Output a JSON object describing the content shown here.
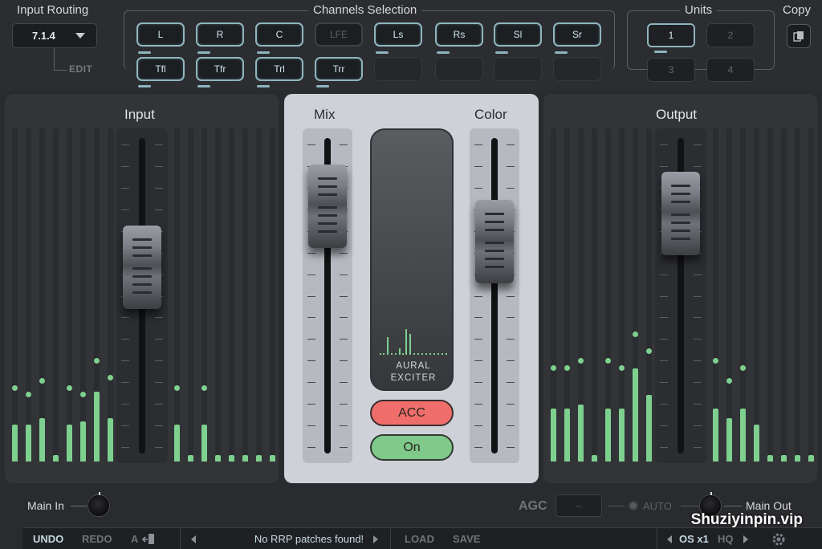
{
  "input_routing": {
    "title": "Input Routing",
    "value": "7.1.4",
    "edit_label": "EDIT"
  },
  "channels": {
    "title": "Channels Selection",
    "row1": [
      "L",
      "R",
      "C",
      "LFE",
      "Ls",
      "Rs",
      "Sl",
      "Sr"
    ],
    "row2": [
      "Tfl",
      "Tfr",
      "Trl",
      "Trr"
    ]
  },
  "units": {
    "title": "Units",
    "items": [
      "1",
      "2",
      "3",
      "4"
    ],
    "active": "1"
  },
  "copy": {
    "label": "Copy"
  },
  "input_panel": {
    "title": "Input",
    "meter_levels": [
      0.11,
      0.11,
      0.13,
      0.02,
      0.11,
      0.12,
      0.21,
      0.13,
      0,
      0.11,
      0.02,
      0.11,
      0.02,
      0.02,
      0.02,
      0.02,
      0.02
    ],
    "meter_peaks": [
      0.23,
      0.21,
      0.25,
      null,
      0.23,
      0.21,
      0.31,
      0.26,
      null,
      0.23,
      null,
      0.23,
      null,
      null,
      null,
      null,
      null
    ]
  },
  "mix": {
    "title": "Mix",
    "value": 0.88
  },
  "color": {
    "title": "Color",
    "value": 0.73
  },
  "exciter": {
    "line1": "AURAL",
    "line2": "EXCITER"
  },
  "acc_button": {
    "label": "ACC"
  },
  "on_button": {
    "label": "On"
  },
  "output_panel": {
    "title": "Output",
    "meter_levels": [
      0.16,
      0.16,
      0.17,
      0.02,
      0.16,
      0.16,
      0.28,
      0.2,
      0,
      0.16,
      0.13,
      0.16,
      0.11,
      0.02,
      0.02,
      0.02,
      0.02
    ],
    "meter_peaks": [
      0.29,
      0.29,
      0.31,
      null,
      0.31,
      0.29,
      0.39,
      0.34,
      null,
      0.31,
      0.25,
      0.29,
      null,
      null,
      null,
      null,
      null
    ]
  },
  "input_fader": {
    "value": 0.62
  },
  "output_fader": {
    "value": 0.85
  },
  "bottom": {
    "main_in": "Main In",
    "main_out": "Main Out",
    "agc": "AGC",
    "agc_value": "--",
    "auto": "AUTO",
    "undo": "UNDO",
    "redo": "REDO",
    "a_label": "A",
    "patch_text": "No RRP patches found!",
    "load": "LOAD",
    "save": "SAVE",
    "os": "OS x1",
    "hq": "HQ"
  },
  "watermark": "Shuziyinpin.vip",
  "colors": {
    "meter": "#7ed08e",
    "accent": "#8fb5bf",
    "acc": "#ef6e6b",
    "on": "#7fc98a"
  }
}
